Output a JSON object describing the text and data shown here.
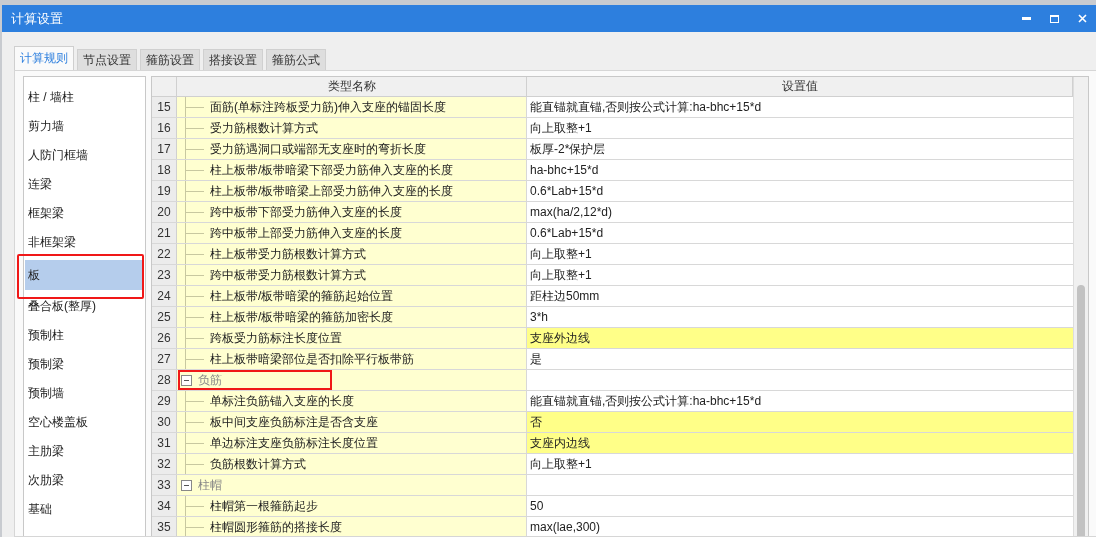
{
  "window": {
    "title": "计算设置"
  },
  "tabs": [
    {
      "label": "计算规则",
      "selected": true
    },
    {
      "label": "节点设置",
      "selected": false
    },
    {
      "label": "箍筋设置",
      "selected": false
    },
    {
      "label": "搭接设置",
      "selected": false
    },
    {
      "label": "箍筋公式",
      "selected": false
    }
  ],
  "sidebar": {
    "items": [
      {
        "label": "柱 / 墙柱",
        "selected": false,
        "annotated": false
      },
      {
        "label": "剪力墙",
        "selected": false,
        "annotated": false
      },
      {
        "label": "人防门框墙",
        "selected": false,
        "annotated": false
      },
      {
        "label": "连梁",
        "selected": false,
        "annotated": false
      },
      {
        "label": "框架梁",
        "selected": false,
        "annotated": false
      },
      {
        "label": "非框架梁",
        "selected": false,
        "annotated": false
      },
      {
        "label": "板",
        "selected": true,
        "annotated": true
      },
      {
        "label": "叠合板(整厚)",
        "selected": false,
        "annotated": false
      },
      {
        "label": "预制柱",
        "selected": false,
        "annotated": false
      },
      {
        "label": "预制梁",
        "selected": false,
        "annotated": false
      },
      {
        "label": "预制墙",
        "selected": false,
        "annotated": false
      },
      {
        "label": "空心楼盖板",
        "selected": false,
        "annotated": false
      },
      {
        "label": "主肋梁",
        "selected": false,
        "annotated": false
      },
      {
        "label": "次肋梁",
        "selected": false,
        "annotated": false
      },
      {
        "label": "基础",
        "selected": false,
        "annotated": false
      }
    ]
  },
  "table": {
    "columns": [
      "类型名称",
      "设置值"
    ],
    "rows": [
      {
        "kind": "item",
        "number": "15",
        "name": "面筋(单标注跨板受力筋)伸入支座的锚固长度",
        "value": "能直锚就直锚,否则按公式计算:ha-bhc+15*d",
        "highlighted": false
      },
      {
        "kind": "item",
        "number": "16",
        "name": "受力筋根数计算方式",
        "value": "向上取整+1",
        "highlighted": false
      },
      {
        "kind": "item",
        "number": "17",
        "name": "受力筋遇洞口或端部无支座时的弯折长度",
        "value": "板厚-2*保护层",
        "highlighted": false
      },
      {
        "kind": "item",
        "number": "18",
        "name": "柱上板带/板带暗梁下部受力筋伸入支座的长度",
        "value": "ha-bhc+15*d",
        "highlighted": false
      },
      {
        "kind": "item",
        "number": "19",
        "name": "柱上板带/板带暗梁上部受力筋伸入支座的长度",
        "value": "0.6*Lab+15*d",
        "highlighted": false
      },
      {
        "kind": "item",
        "number": "20",
        "name": "跨中板带下部受力筋伸入支座的长度",
        "value": "max(ha/2,12*d)",
        "highlighted": false
      },
      {
        "kind": "item",
        "number": "21",
        "name": "跨中板带上部受力筋伸入支座的长度",
        "value": "0.6*Lab+15*d",
        "highlighted": false
      },
      {
        "kind": "item",
        "number": "22",
        "name": "柱上板带受力筋根数计算方式",
        "value": "向上取整+1",
        "highlighted": false
      },
      {
        "kind": "item",
        "number": "23",
        "name": "跨中板带受力筋根数计算方式",
        "value": "向上取整+1",
        "highlighted": false
      },
      {
        "kind": "item",
        "number": "24",
        "name": "柱上板带/板带暗梁的箍筋起始位置",
        "value": "距柱边50mm",
        "highlighted": false
      },
      {
        "kind": "item",
        "number": "25",
        "name": "柱上板带/板带暗梁的箍筋加密长度",
        "value": "3*h",
        "highlighted": false
      },
      {
        "kind": "item",
        "number": "26",
        "name": "跨板受力筋标注长度位置",
        "value": "支座外边线",
        "highlighted": true
      },
      {
        "kind": "item",
        "number": "27",
        "name": "柱上板带暗梁部位是否扣除平行板带筋",
        "value": "是",
        "highlighted": false
      },
      {
        "kind": "group",
        "number": "28",
        "name": "负筋",
        "expanded": true,
        "annotated": true,
        "children": [
          {
            "kind": "item",
            "number": "29",
            "name": "单标注负筋锚入支座的长度",
            "value": "能直锚就直锚,否则按公式计算:ha-bhc+15*d",
            "highlighted": false
          },
          {
            "kind": "item",
            "number": "30",
            "name": "板中间支座负筋标注是否含支座",
            "value": "否",
            "highlighted": true
          },
          {
            "kind": "item",
            "number": "31",
            "name": "单边标注支座负筋标注长度位置",
            "value": "支座内边线",
            "highlighted": true
          },
          {
            "kind": "item",
            "number": "32",
            "name": "负筋根数计算方式",
            "value": "向上取整+1",
            "highlighted": false
          }
        ]
      },
      {
        "kind": "group",
        "number": "33",
        "name": "柱帽",
        "expanded": true,
        "children": [
          {
            "kind": "item",
            "number": "34",
            "name": "柱帽第一根箍筋起步",
            "value": "50",
            "highlighted": false
          },
          {
            "kind": "item",
            "number": "35",
            "name": "柱帽圆形箍筋的搭接长度",
            "value": "max(lae,300)",
            "highlighted": false
          }
        ]
      }
    ]
  }
}
